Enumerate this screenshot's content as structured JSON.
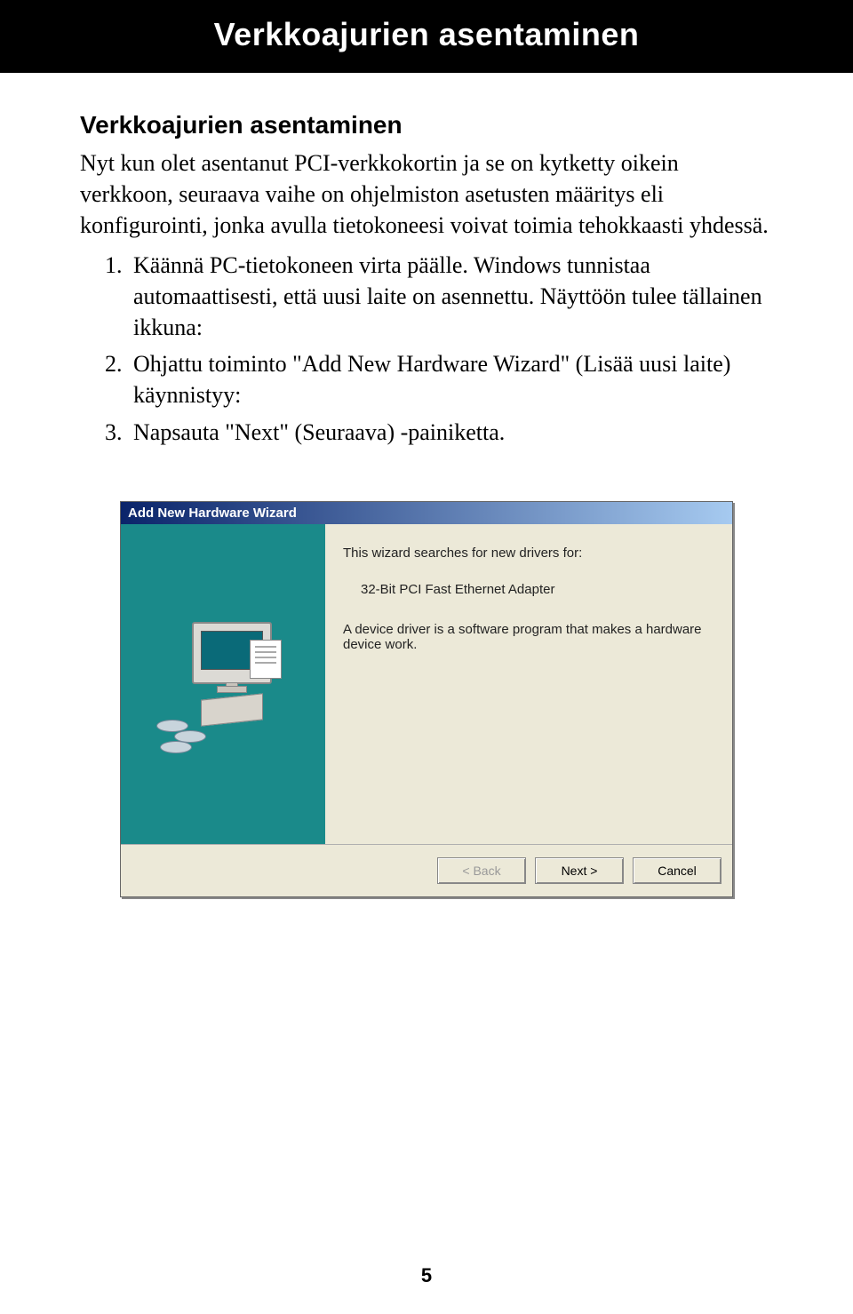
{
  "banner_title": "Verkkoajurien asentaminen",
  "section_heading": "Verkkoajurien asentaminen",
  "intro_text": "Nyt kun olet asentanut PCI-verkkokortin ja se on kytketty oikein verkkoon, seuraava vaihe on ohjelmiston asetusten määritys eli konfigurointi, jonka avulla tietokoneesi voivat toimia tehokkaasti yhdessä.",
  "steps": [
    "Käännä PC-tietokoneen virta päälle. Windows tunnistaa automaattisesti, että uusi laite on asennettu. Näyttöön tulee tällainen ikkuna:",
    "Ohjattu toiminto \"Add New Hardware Wizard\" (Lisää uusi laite) käynnistyy:",
    "Napsauta \"Next\" (Seuraava) -painiketta."
  ],
  "wizard": {
    "title": "Add New Hardware Wizard",
    "line1": "This wizard searches for new drivers for:",
    "line2": "32-Bit PCI Fast Ethernet Adapter",
    "line3": "A device driver is a software program that makes a hardware device work.",
    "buttons": {
      "back": "< Back",
      "next": "Next >",
      "cancel": "Cancel"
    }
  },
  "page_number": "5"
}
